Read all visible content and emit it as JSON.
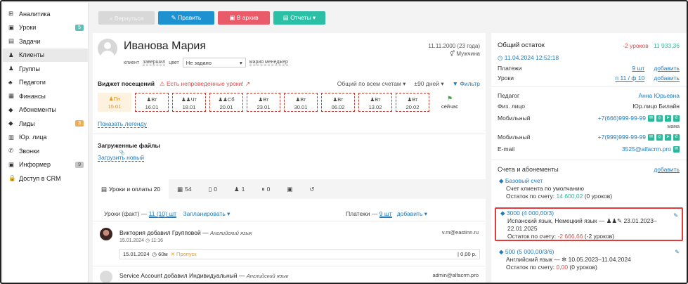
{
  "sidebar": {
    "items": [
      {
        "icon": "⊞",
        "label": "Аналитика",
        "badge": ""
      },
      {
        "icon": "▣",
        "label": "Уроки",
        "badge": "5"
      },
      {
        "icon": "▤",
        "label": "Задачи",
        "badge": ""
      },
      {
        "icon": "♟",
        "label": "Клиенты",
        "badge": ""
      },
      {
        "icon": "♟",
        "label": "Группы",
        "badge": ""
      },
      {
        "icon": "♣",
        "label": "Педагоги",
        "badge": ""
      },
      {
        "icon": "▦",
        "label": "Финансы",
        "badge": ""
      },
      {
        "icon": "◆",
        "label": "Абонементы",
        "badge": ""
      },
      {
        "icon": "◆",
        "label": "Лиды",
        "badge": "3"
      },
      {
        "icon": "▥",
        "label": "Юр. лица",
        "badge": ""
      },
      {
        "icon": "✆",
        "label": "Звонки",
        "badge": ""
      },
      {
        "icon": "▣",
        "label": "Информер",
        "badge": "9"
      },
      {
        "icon": "🔒",
        "label": "Доступ в CRM",
        "badge": ""
      }
    ]
  },
  "toolbar": {
    "back": "« Вернуться",
    "edit": "✎ Править",
    "archive": "▣ В архив",
    "reports": "▤ Отчеты ▾"
  },
  "client": {
    "name": "Иванова Мария",
    "meta": [
      "клиент",
      "завершил",
      "цвет"
    ],
    "status_select": "Не задано",
    "manager": "мария менеджер",
    "dob": "11.11.2000 (23 года)",
    "gender": "⚥ Мужчина"
  },
  "widget": {
    "title": "Виджет посещений",
    "warning": "⚠ Есть непроведенные уроки! ↗",
    "scope": "Общий по всем счетам ▾",
    "range": "±90 дней ▾",
    "filter": "▼ Фильтр",
    "days": [
      {
        "day": "Пн",
        "date": "15.01",
        "type": "today"
      },
      {
        "day": "Вт",
        "date": "16.01",
        "type": "missed"
      },
      {
        "day": "Чт",
        "date": "18.01",
        "type": "missed"
      },
      {
        "day": "Сб",
        "date": "20.01",
        "type": "missed"
      },
      {
        "day": "Вт",
        "date": "23.01",
        "type": "missed"
      },
      {
        "day": "Вт",
        "date": "30.01",
        "type": "missed"
      },
      {
        "day": "Вт",
        "date": "06.02",
        "type": "missed"
      },
      {
        "day": "Вт",
        "date": "13.02",
        "type": "missed"
      },
      {
        "day": "Вт",
        "date": "20.02",
        "type": "missed"
      },
      {
        "day": "сейчас",
        "date": "",
        "type": "flag"
      }
    ],
    "legend_link": "Показать легенду"
  },
  "files": {
    "title": "Загруженные файлы",
    "upload": "Загрузить новый"
  },
  "tabs": [
    {
      "icon": "▤",
      "label": "Уроки и оплаты 20"
    },
    {
      "icon": "▦",
      "label": "54"
    },
    {
      "icon": "▯",
      "label": "0"
    },
    {
      "icon": "♟",
      "label": "1"
    },
    {
      "icon": "⏸",
      "label": "0"
    },
    {
      "icon": "▣",
      "label": ""
    },
    {
      "icon": "↺",
      "label": ""
    }
  ],
  "lessons_row": {
    "lessons_label": "Уроки (факт) —",
    "lessons_count": "11 (10) шт",
    "plan": "Запланировать ▾",
    "payments_label": "Платежи —",
    "payments_count": "9 шт",
    "add": "добавить ▾"
  },
  "feed": [
    {
      "text": "Виктория добавил Групповой —",
      "subject": "Английский язык",
      "sub": "15.01.2024 ◷ 11:16",
      "email": "v.m@eastinn.ru",
      "lesson_date": "15.01.2024",
      "lesson_duration": "◷ 60м",
      "lesson_status": "✕ Пропуск",
      "lesson_price": "| 0,00 р."
    },
    {
      "text": "Service Account добавил Индивидуальный —",
      "subject": "Английский язык",
      "email": "admin@alfacrm.pro"
    }
  ],
  "right": {
    "title": "Общий остаток",
    "lessons_left": "-2 уроков",
    "balance": "11 933,36",
    "updated": "◷ 11.04.2024 12:52:18",
    "payments_label": "Платежи",
    "payments_count": "9 шт",
    "payments_add": "добавить",
    "lessons_label": "Уроки",
    "lessons_count": "п 11 / ф 10",
    "lessons_add": "добавить",
    "teacher_label": "Педагог",
    "teacher": "Анна Юрьевна",
    "person_label": "Физ. лицо",
    "person": "Юр.лицо Билайн",
    "mobile_label": "Мобильный",
    "mobile1": "+7(666)999-99-99",
    "mobile1_note": "мама",
    "mobile2": "+7(999)999-99-99",
    "email_label": "E-mail",
    "email": "3525@alfacrm.pro",
    "accounts_title": "Счета и абонементы",
    "accounts_add": "добавить",
    "accounts": [
      {
        "title": "Базовый счет",
        "line1": "Счет клиента по умолчанию",
        "rest_label": "Остаток по счету:",
        "rest_value": "14 600,02",
        "rest_lessons": "(0 уроков)"
      },
      {
        "title": "3000 (4 000,00/3)",
        "line1": "Испанский язык, Немецкий язык —",
        "line1b": "23.01.2023–",
        "line2": "22.01.2025",
        "rest_label": "Остаток по счету:",
        "rest_value": "-2 666,66",
        "rest_lessons": "(-2 уроков)"
      },
      {
        "title": "500 (5 000,00/3/6)",
        "line1": "Английский язык — ✲ 10.05.2023–11.04.2024",
        "rest_label": "Остаток по счету:",
        "rest_value": "0,00",
        "rest_lessons": "(0 уроков)"
      }
    ]
  }
}
